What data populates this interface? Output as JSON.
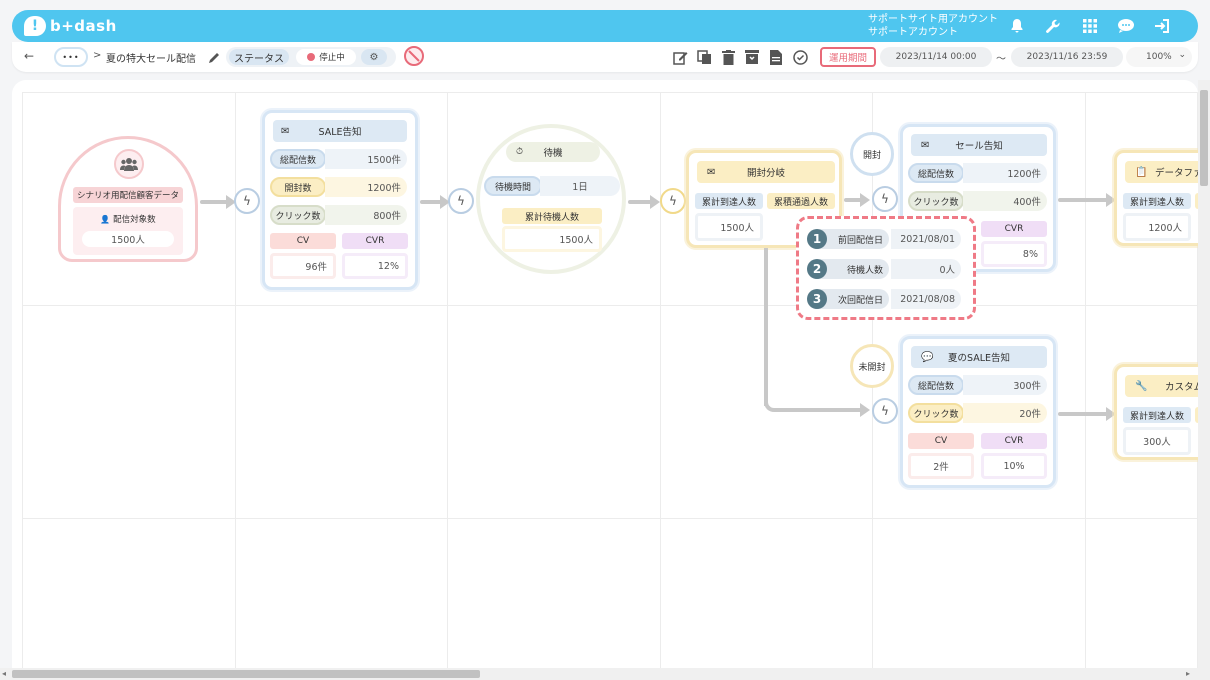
{
  "header": {
    "logo_text": "b+dash",
    "account_line1": "サポートサイト用アカウント",
    "account_line2": "サポートアカウント",
    "icons": [
      "bell-icon",
      "wrench-icon",
      "grid-icon",
      "chat-icon",
      "logout-icon"
    ]
  },
  "toolbar": {
    "back_glyph": "←",
    "more_glyph": "•••",
    "breadcrumb_sep": ">",
    "scenario_title": "夏の特大セール配信",
    "status_label": "ステータス",
    "status_value": "停止中",
    "period_label": "運用期間",
    "start_datetime": "2023/11/14 00:00",
    "tilde": "〜",
    "end_datetime": "2023/11/16 23:59",
    "zoom": "100%",
    "tool_icons": [
      "edit-icon",
      "copy-icon",
      "trash-icon",
      "archive-icon",
      "document-icon",
      "check-circle-icon"
    ]
  },
  "nodes": {
    "audience": {
      "title": "シナリオ用配信顧客データ",
      "target_label": "配信対象数",
      "target_value": "1500人"
    },
    "sale_notice": {
      "title": "SALE告知",
      "rows": [
        {
          "label": "総配信数",
          "value": "1500件"
        },
        {
          "label": "開封数",
          "value": "1200件"
        },
        {
          "label": "クリック数",
          "value": "800件"
        }
      ],
      "cv_label": "CV",
      "cv_value": "96件",
      "cvr_label": "CVR",
      "cvr_value": "12%"
    },
    "wait": {
      "title": "待機",
      "time_label": "待機時間",
      "time_value": "1日",
      "count_label": "累計待機人数",
      "count_value": "1500人"
    },
    "open_branch": {
      "title": "開封分岐",
      "reach_label": "累計到達人数",
      "reach_value": "1500人",
      "pass_label": "累積通過人数"
    },
    "sale_mail": {
      "pin": "開封",
      "title": "セール告知",
      "rows": [
        {
          "label": "総配信数",
          "value": "1200件"
        },
        {
          "label": "クリック数",
          "value": "400件"
        }
      ],
      "cvr_label": "CVR",
      "cvr_value": "8%"
    },
    "summer_sale": {
      "pin": "未開封",
      "title": "夏のSALE告知",
      "rows": [
        {
          "label": "総配信数",
          "value": "300件"
        },
        {
          "label": "クリック数",
          "value": "20件"
        }
      ],
      "cv_label": "CV",
      "cv_value": "2件",
      "cvr_label": "CVR",
      "cvr_value": "10%"
    },
    "data_node": {
      "title": "データファ",
      "reach_label": "累計到達人数",
      "reach_value": "1200人"
    },
    "custom_node": {
      "title": "カスタム",
      "reach_label": "累計到達人数",
      "reach_value": "300人"
    }
  },
  "popup": {
    "rows": [
      {
        "num": "1",
        "label": "前回配信日",
        "value": "2021/08/01"
      },
      {
        "num": "2",
        "label": "待機人数",
        "value": "0人"
      },
      {
        "num": "3",
        "label": "次回配信日",
        "value": "2021/08/08"
      }
    ]
  },
  "colors": {
    "brand": "#4fc6ef",
    "popup_border": "#ef7a86",
    "period_border": "#e86a79"
  }
}
